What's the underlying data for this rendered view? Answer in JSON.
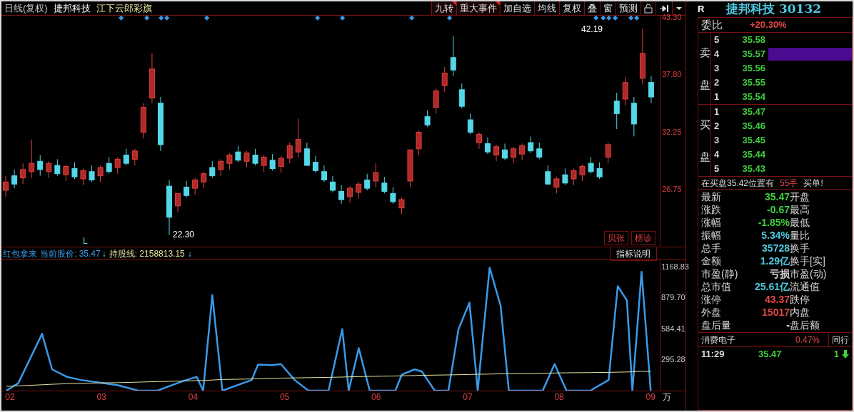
{
  "toolbar": {
    "period": "日线(复权)",
    "stock_name": "捷邦科技",
    "formula_name": "江下云郎彩旗",
    "buttons": [
      {
        "label": "九转",
        "flagged": true
      },
      {
        "label": "重大事件",
        "flagged": true
      },
      {
        "label": "加自选",
        "flagged": false
      },
      {
        "label": "均线",
        "flagged": false
      },
      {
        "label": "复权",
        "flagged": false
      },
      {
        "label": "叠",
        "flagged": false
      },
      {
        "label": "窗",
        "flagged": false
      },
      {
        "label": "预测",
        "flagged": false
      }
    ]
  },
  "price_chart": {
    "high_label": "42.19",
    "low_label": "22.30",
    "marker": "L",
    "corner_buttons": [
      "贝张",
      "榜诊"
    ],
    "chart_data": {
      "type": "candlestick",
      "categories": [
        null,
        null,
        null,
        null,
        null,
        null,
        null,
        null,
        null,
        null,
        null,
        null,
        null,
        null,
        null,
        null,
        null,
        null,
        null,
        null,
        null,
        null,
        null,
        null,
        null,
        null,
        null,
        null,
        null,
        null,
        null,
        null,
        null,
        null,
        null,
        null,
        null,
        null,
        null,
        null,
        null,
        null,
        null,
        null,
        null,
        null,
        null,
        null,
        null,
        null,
        null,
        null,
        null,
        null,
        null,
        null,
        null,
        null,
        null,
        null,
        null,
        null,
        null,
        null,
        null,
        null,
        null,
        null,
        null,
        null,
        null,
        null,
        null,
        null,
        null,
        null
      ],
      "ohlc": [
        [
          26.6,
          28,
          26,
          27.4
        ],
        [
          28,
          28.6,
          26.8,
          27.2
        ],
        [
          27.8,
          29.2,
          27.2,
          28.6
        ],
        [
          28.4,
          31.5,
          27.8,
          29.2
        ],
        [
          29.4,
          30,
          28,
          28.6
        ],
        [
          28.4,
          29.4,
          27.8,
          29.2
        ],
        [
          29,
          29.6,
          28,
          28.2
        ],
        [
          28.1,
          29.1,
          27.5,
          28.9
        ],
        [
          28.7,
          29.3,
          27.7,
          27.9
        ],
        [
          27.7,
          28.7,
          27.1,
          28.5
        ],
        [
          28.4,
          29,
          27.4,
          27.6
        ],
        [
          28,
          29,
          27.4,
          28.8
        ],
        [
          29.2,
          29.8,
          28.2,
          28.4
        ],
        [
          28.8,
          29.8,
          28.2,
          29.6
        ],
        [
          30,
          30.6,
          29,
          29.2
        ],
        [
          29.6,
          30.6,
          29,
          30.4
        ],
        [
          32.2,
          35,
          31.6,
          34.6
        ],
        [
          35.5,
          39.8,
          35,
          38.3
        ],
        [
          35,
          35.6,
          30.4,
          31
        ],
        [
          27,
          27.6,
          22.3,
          24
        ],
        [
          25.1,
          26.3,
          24.5,
          26.3
        ],
        [
          26.9,
          27.5,
          25.9,
          26.1
        ],
        [
          26.8,
          27.8,
          26.2,
          27.6
        ],
        [
          27.4,
          28.4,
          26.8,
          28.2
        ],
        [
          28.8,
          29.4,
          27.8,
          28
        ],
        [
          28.6,
          29.6,
          28,
          29.4
        ],
        [
          29.2,
          30.2,
          28.6,
          30
        ],
        [
          30.3,
          30.9,
          29.3,
          29.5
        ],
        [
          29.4,
          30.4,
          28.8,
          30.2
        ],
        [
          30,
          30.6,
          29,
          29.2
        ],
        [
          29,
          30,
          28.4,
          29.8
        ],
        [
          29.5,
          30.1,
          28.5,
          28.7
        ],
        [
          28.9,
          29.9,
          28.3,
          29.7
        ],
        [
          29.7,
          31.2,
          29.2,
          30.9
        ],
        [
          30.3,
          33.5,
          29.8,
          31.5
        ],
        [
          30.6,
          31.2,
          29,
          29
        ],
        [
          29.3,
          29.9,
          28.3,
          28.5
        ],
        [
          28.4,
          29,
          27.4,
          27.6
        ],
        [
          27.4,
          28,
          26.4,
          26.6
        ],
        [
          26.5,
          27.1,
          25.3,
          25.7
        ],
        [
          26,
          27,
          25.4,
          26.8
        ],
        [
          26.4,
          27.4,
          25.8,
          27.2
        ],
        [
          27.6,
          28.2,
          26.6,
          26.8
        ],
        [
          27.5,
          29.2,
          26.9,
          28.3
        ],
        [
          27.3,
          27.9,
          26.3,
          26.5
        ],
        [
          26.3,
          26.9,
          25.3,
          25.5
        ],
        [
          24.9,
          25.9,
          24.3,
          25.7
        ],
        [
          27.5,
          30.5,
          26.9,
          30.5
        ],
        [
          30.6,
          32.4,
          30,
          32.2
        ],
        [
          33.7,
          34.3,
          32.7,
          32.9
        ],
        [
          34.6,
          36.4,
          34,
          36.2
        ],
        [
          36.7,
          38.5,
          36.1,
          37.9
        ],
        [
          39.4,
          41.5,
          37.6,
          38.2
        ],
        [
          36.3,
          36.9,
          34.5,
          34.7
        ],
        [
          33.4,
          34,
          32,
          32.2
        ],
        [
          31.2,
          32.2,
          30.6,
          32
        ],
        [
          31.1,
          31.7,
          30.1,
          30.3
        ],
        [
          30,
          31,
          29.4,
          30.8
        ],
        [
          30.5,
          31.1,
          29.5,
          29.7
        ],
        [
          29.8,
          30.8,
          29.2,
          30.6
        ],
        [
          30.1,
          31.1,
          29.5,
          30.9
        ],
        [
          31.2,
          31.8,
          30.2,
          30.4
        ],
        [
          30.6,
          31.2,
          29.6,
          29.8
        ],
        [
          28.4,
          29,
          27.2,
          27.2
        ],
        [
          26.9,
          27.9,
          26.3,
          27.7
        ],
        [
          28.1,
          28.7,
          27.1,
          27.3
        ],
        [
          27.7,
          28.7,
          27.1,
          28.5
        ],
        [
          28.1,
          29.1,
          27.5,
          28.9
        ],
        [
          29.2,
          29.8,
          28.2,
          28.4
        ],
        [
          28.7,
          29.3,
          27.7,
          27.9
        ],
        [
          29.8,
          31.2,
          29.2,
          31
        ],
        [
          35.2,
          36,
          32.5,
          34
        ],
        [
          35.4,
          37.5,
          34.8,
          37
        ],
        [
          35,
          35.6,
          31.8,
          33
        ],
        [
          37.4,
          42.19,
          36.8,
          39.8
        ],
        [
          37,
          37.6,
          35,
          35.6
        ]
      ],
      "ylim": [
        21.1,
        43.44
      ],
      "yticks": [
        {
          "value": 43.3,
          "label": "43.30"
        },
        {
          "value": 37.8,
          "label": "37.80"
        },
        {
          "value": 32.25,
          "label": "32.25"
        },
        {
          "value": 26.75,
          "label": "26.75"
        }
      ]
    }
  },
  "indicator": {
    "price_label": "当前股价: 35.47",
    "price_arrow": "↓",
    "line_value": ": 2158813.15",
    "line_arrow": "↓",
    "help_button": "指标说明",
    "unit": "万",
    "chart_data": {
      "type": "line",
      "x": [
        1.96,
        2.09,
        2.35,
        2.46,
        2.62,
        2.78,
        3.18,
        3.4,
        3.61,
        3.89,
        4.04,
        4.11,
        4.21,
        4.32,
        4.64,
        4.71,
        4.86,
        4.96,
        5.11,
        5.26,
        5.48,
        5.63,
        5.7,
        5.81,
        5.93,
        6.07,
        6.21,
        6.28,
        6.42,
        6.5,
        6.64,
        6.79,
        6.9,
        7.02,
        7.11,
        7.24,
        7.36,
        7.45,
        7.7,
        7.82,
        7.95,
        8.08,
        8.34,
        8.54,
        8.64,
        8.74,
        8.8,
        8.9,
        9.0
      ],
      "series": [
        {
          "name": "红包拿来",
          "color": "#3a9ae8",
          "values": [
            0,
            70,
            535,
            200,
            130,
            100,
            50,
            0,
            0,
            90,
            130,
            0,
            900,
            0,
            100,
            245,
            240,
            250,
            100,
            0,
            0,
            580,
            0,
            400,
            0,
            0,
            0,
            150,
            200,
            180,
            0,
            0,
            580,
            830,
            0,
            1160,
            800,
            0,
            0,
            0,
            250,
            0,
            0,
            100,
            985,
            850,
            0,
            1120,
            0
          ]
        },
        {
          "name": "持股线",
          "color": "#e8e4a0",
          "values": [
            40,
            45,
            55,
            60,
            65,
            70,
            75,
            80,
            85,
            90,
            95,
            95,
            100,
            105,
            110,
            112,
            115,
            118,
            120,
            122,
            125,
            128,
            130,
            132,
            134,
            136,
            138,
            140,
            142,
            144,
            146,
            148,
            150,
            152,
            154,
            156,
            158,
            160,
            162,
            164,
            166,
            168,
            170,
            172,
            174,
            176,
            178,
            182,
            180
          ]
        }
      ],
      "xlim": [
        1.906,
        9.38
      ],
      "ylim": [
        0,
        1230
      ],
      "xticks": [
        {
          "value": 2,
          "label": "02"
        },
        {
          "value": 3,
          "label": "03"
        },
        {
          "value": 4,
          "label": "04"
        },
        {
          "value": 5,
          "label": "05"
        },
        {
          "value": 6,
          "label": "06"
        },
        {
          "value": 7,
          "label": "07"
        },
        {
          "value": 8,
          "label": "08"
        },
        {
          "value": 9,
          "label": "09"
        }
      ],
      "yticks": [
        {
          "value": 295.28,
          "label": "295.28"
        },
        {
          "value": 584.41,
          "label": "584.41"
        },
        {
          "value": 879.7,
          "label": "879.70"
        },
        {
          "value": 1168.83,
          "label": "1168.83"
        }
      ]
    }
  },
  "quote": {
    "mark": "R",
    "title": "捷邦科技 30132",
    "ratio_label": "委比",
    "ratio_value": "+20.30%",
    "sell_label": "卖盘",
    "sell": [
      {
        "level": "5",
        "price": "35.58",
        "highlighted": false
      },
      {
        "level": "4",
        "price": "35.57",
        "highlighted": true
      },
      {
        "level": "3",
        "price": "35.56",
        "highlighted": false
      },
      {
        "level": "2",
        "price": "35.55",
        "highlighted": false
      },
      {
        "level": "1",
        "price": "35.54",
        "highlighted": false
      }
    ],
    "buy_label": "买盘",
    "buy": [
      {
        "level": "1",
        "price": "35.47",
        "highlighted": false
      },
      {
        "level": "2",
        "price": "35.46",
        "highlighted": false
      },
      {
        "level": "3",
        "price": "35.45",
        "highlighted": false
      },
      {
        "level": "4",
        "price": "35.44",
        "highlighted": false
      },
      {
        "level": "5",
        "price": "35.43",
        "highlighted": false
      }
    ],
    "notice": {
      "text": "在买盘35.42位置有",
      "lots": "55手",
      "suffix": "买单!"
    },
    "stats": [
      {
        "label": "最新",
        "value": "35.47",
        "color": "#3fcf3f",
        "right_label": "开盘"
      },
      {
        "label": "涨跌",
        "value": "-0.67",
        "color": "#3fcf3f",
        "right_label": "最高"
      },
      {
        "label": "涨幅",
        "value": "-1.85%",
        "color": "#3fcf3f",
        "right_label": "最低"
      },
      {
        "label": "振幅",
        "value": "5.34%",
        "color": "#4fc8e0",
        "right_label": "量比"
      },
      {
        "label": "总手",
        "value": "35728",
        "color": "#4fc8e0",
        "right_label": "换手"
      },
      {
        "label": "金额",
        "value": "1.29亿",
        "color": "#4fc8e0",
        "right_label": "换手[实]"
      },
      {
        "label": "市盈(静)",
        "value": "亏损",
        "color": "#d8d8d8",
        "right_label": "市盈(动)"
      },
      {
        "label": "总市值",
        "value": "25.61亿",
        "color": "#4fc8e0",
        "right_label": "流通值"
      },
      {
        "label": "涨停",
        "value": "43.37",
        "color": "#e04848",
        "right_label": "跌停"
      },
      {
        "label": "外盘",
        "value": "15017",
        "color": "#e04848",
        "right_label": "内盘"
      },
      {
        "label": "盘后量",
        "value": "-",
        "color": "#ffffff",
        "right_label": "盘后额"
      }
    ],
    "sector": {
      "name": "消费电子",
      "change": "0.47%",
      "button": "同行"
    },
    "ticks": [
      {
        "time": "11:29",
        "price": "35.47",
        "volume": "1",
        "down": true
      }
    ]
  }
}
